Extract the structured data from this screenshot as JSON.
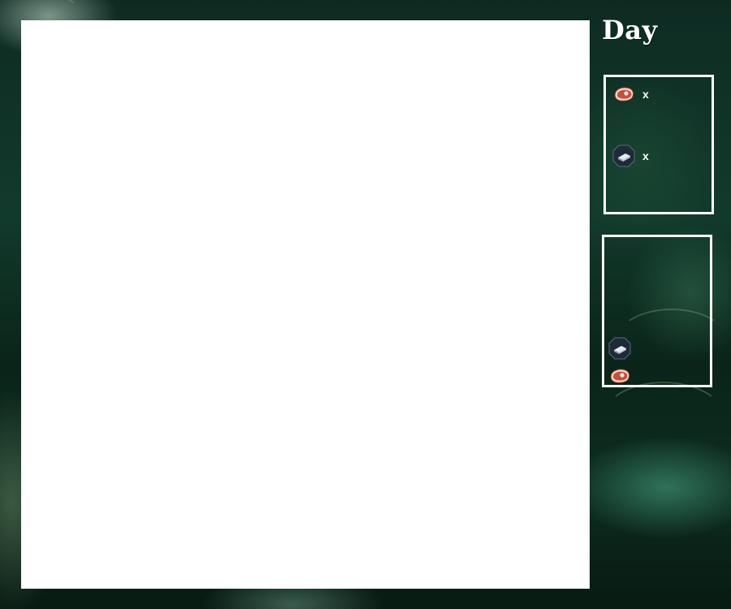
{
  "hud": {
    "title": "Day",
    "resources": [
      {
        "icon": "meat-icon",
        "label": "x"
      },
      {
        "icon": "stone-slab-icon",
        "label": "x"
      }
    ],
    "inventory": [
      {
        "icon": "stone-slab-icon"
      },
      {
        "icon": "meat-icon"
      }
    ]
  },
  "colors": {
    "panel_border": "#ffffff",
    "canvas": "#ffffff",
    "meat": "#c0523f",
    "stone_badge": "#1f2a38"
  }
}
